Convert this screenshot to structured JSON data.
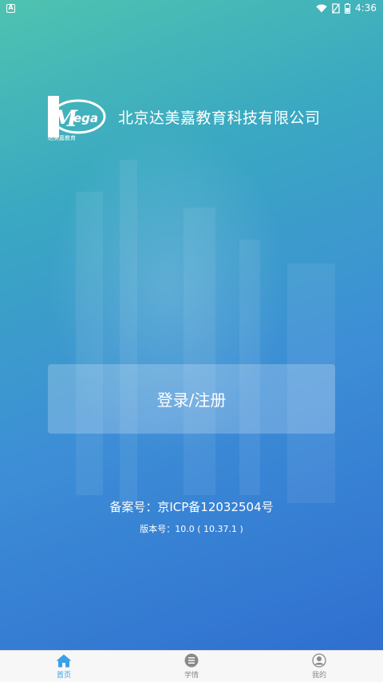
{
  "status_bar": {
    "time": "4:36",
    "left_icon": "app-notification-icon",
    "icons": [
      "wifi-icon",
      "no-sim-icon",
      "battery-icon"
    ]
  },
  "brand": {
    "logo_text": "Mega",
    "logo_caption": "达美嘉教育",
    "company_name": "北京达美嘉教育科技有限公司"
  },
  "login": {
    "label": "登录/注册"
  },
  "footer": {
    "icp": "备案号：京ICP备12032504号",
    "version": "版本号：10.0 ( 10.37.1 )"
  },
  "tabbar": {
    "active_color": "#3aa0e8",
    "inactive_color": "#8a8a8a",
    "tabs": [
      {
        "label": "首页",
        "icon": "home-icon",
        "active": true
      },
      {
        "label": "学情",
        "icon": "list-icon",
        "active": false
      },
      {
        "label": "我的",
        "icon": "profile-icon",
        "active": false
      }
    ]
  }
}
